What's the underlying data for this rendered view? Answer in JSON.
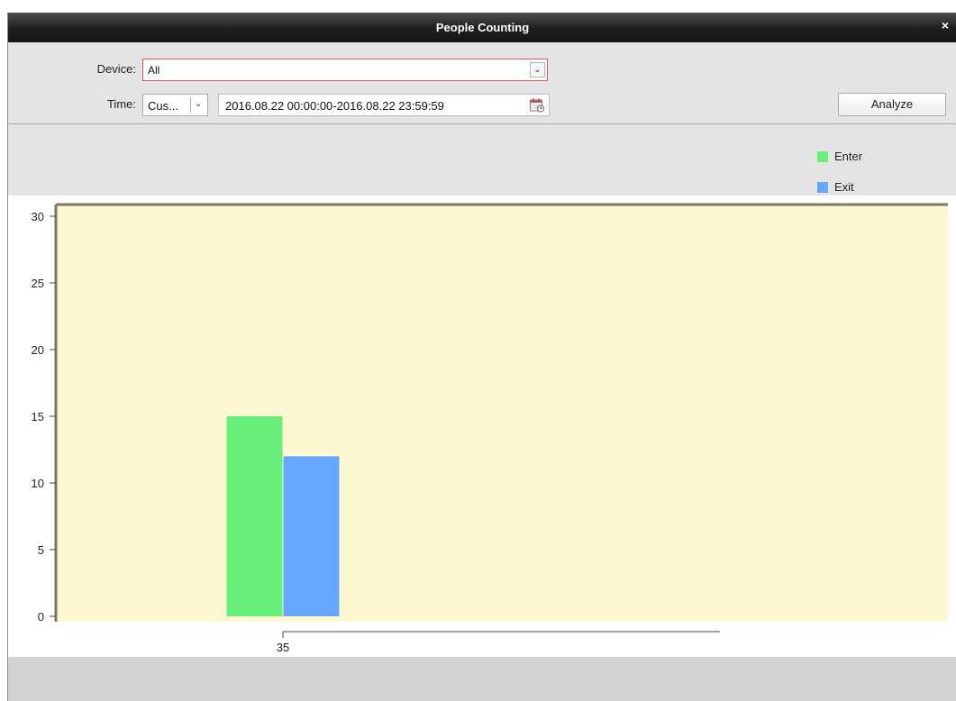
{
  "window": {
    "title": "People Counting",
    "close_label": "×"
  },
  "filters": {
    "device_label": "Device:",
    "device_value": "All",
    "time_label": "Time:",
    "time_type_value": "Cus...",
    "time_range_value": "2016.08.22 00:00:00-2016.08.22 23:59:59",
    "dropdown_glyph": "⌄"
  },
  "actions": {
    "analyze_label": "Analyze"
  },
  "colors": {
    "enter": "#66f07a",
    "exit": "#66a6ff",
    "plot_bg": "#fdf8d2"
  },
  "chart_data": {
    "type": "bar",
    "categories": [
      "35"
    ],
    "series": [
      {
        "name": "Enter",
        "values": [
          15
        ]
      },
      {
        "name": "Exit",
        "values": [
          12
        ]
      }
    ],
    "ylim": [
      0,
      30
    ],
    "yticks": [
      "0",
      "5",
      "10",
      "15",
      "20",
      "25",
      "30"
    ],
    "legend_position": "top-right",
    "grid": false
  }
}
